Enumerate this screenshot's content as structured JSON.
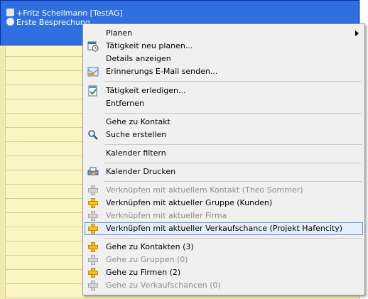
{
  "appointment": {
    "contact_line": "+Fritz Schellmann [TestAG]",
    "subject_line": "Erste Besprechung"
  },
  "menu": {
    "items": [
      {
        "label": "Planen",
        "icon": "none",
        "has_submenu": true,
        "enabled": true
      },
      {
        "label": "Tätigkeit neu planen...",
        "icon": "calendar-clock-icon",
        "enabled": true
      },
      {
        "label": "Details anzeigen",
        "icon": "none",
        "enabled": true
      },
      {
        "label": "Erinnerungs E-Mail senden...",
        "icon": "mail-icon",
        "enabled": true
      },
      {
        "label": "Tätigkeit erledigen...",
        "icon": "checklist-icon",
        "enabled": true
      },
      {
        "label": "Entfernen",
        "icon": "none",
        "enabled": true
      },
      {
        "label": "Gehe zu Kontakt",
        "icon": "none",
        "enabled": true
      },
      {
        "label": "Suche erstellen",
        "icon": "magnifier-icon",
        "enabled": true
      },
      {
        "label": "Kalender filtern",
        "icon": "none",
        "enabled": true
      },
      {
        "label": "Kalender Drucken",
        "icon": "print-icon",
        "enabled": true
      },
      {
        "label": "Verknüpfen mit aktuellem Kontakt (Theo Sommer)",
        "icon": "plus-icon",
        "enabled": false
      },
      {
        "label": "Verknüpfen mit aktueller Gruppe (Kunden)",
        "icon": "plus-icon",
        "enabled": true
      },
      {
        "label": "Verknüpfen mit aktueller Firma",
        "icon": "plus-icon",
        "enabled": false
      },
      {
        "label": "Verknüpfen mit aktueller Verkaufschance (Projekt Hafencity)",
        "icon": "plus-icon",
        "enabled": true,
        "highlighted": true
      },
      {
        "label": "Gehe zu Kontakten (3)",
        "icon": "plus-icon",
        "enabled": true
      },
      {
        "label": "Gehe zu Gruppen (0)",
        "icon": "plus-icon",
        "enabled": false
      },
      {
        "label": "Gehe zu Firmen (2)",
        "icon": "plus-icon",
        "enabled": true
      },
      {
        "label": "Gehe zu Verkaufschancen (0)",
        "icon": "plus-icon",
        "enabled": false
      }
    ]
  },
  "colors": {
    "appointment_bg": "#2f6fe0",
    "calendar_bg": "#fbf5c2",
    "menu_bg": "#f0f0f0",
    "highlight_bg": "#e6eefc",
    "highlight_border": "#6d8fd4",
    "plus_enabled": "#f5c020",
    "plus_disabled": "#c8c8c8"
  }
}
